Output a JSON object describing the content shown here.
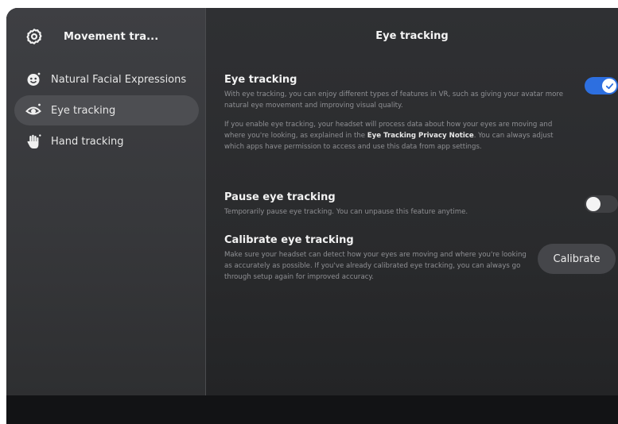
{
  "sidebar": {
    "header": {
      "icon": "gear-icon",
      "title": "Movement tra..."
    },
    "items": [
      {
        "label": "Natural Facial Expressions",
        "icon": "face-icon",
        "active": false
      },
      {
        "label": "Eye tracking",
        "icon": "eye-icon",
        "active": true
      },
      {
        "label": "Hand tracking",
        "icon": "hand-icon",
        "active": false
      }
    ]
  },
  "main": {
    "title": "Eye tracking",
    "eye_tracking": {
      "title": "Eye tracking",
      "description": "With eye tracking, you can enjoy different types of features in VR, such as giving your avatar more natural eye movement and improving visual quality.",
      "privacy_before": "If you enable eye tracking, your headset will process data about how your eyes are moving and where you're looking, as explained in the ",
      "privacy_link": "Eye Tracking Privacy Notice",
      "privacy_after": ". You can always adjust which apps have permission to access and use this data from app settings.",
      "toggle_state": "on"
    },
    "pause": {
      "title": "Pause eye tracking",
      "description": "Temporarily pause eye tracking. You can unpause this feature anytime.",
      "toggle_state": "off"
    },
    "calibrate": {
      "title": "Calibrate eye tracking",
      "description": "Make sure your headset can detect how your eyes are moving and where you're looking as accurately as possible. If you've already calibrated eye tracking, you can always go through setup again for improved accuracy.",
      "button_label": "Calibrate"
    }
  },
  "colors": {
    "accent": "#2d6fe0",
    "sidebar_bg": "#3e3f43",
    "main_bg": "#2f3033",
    "active_item_bg": "#4d4e52"
  }
}
